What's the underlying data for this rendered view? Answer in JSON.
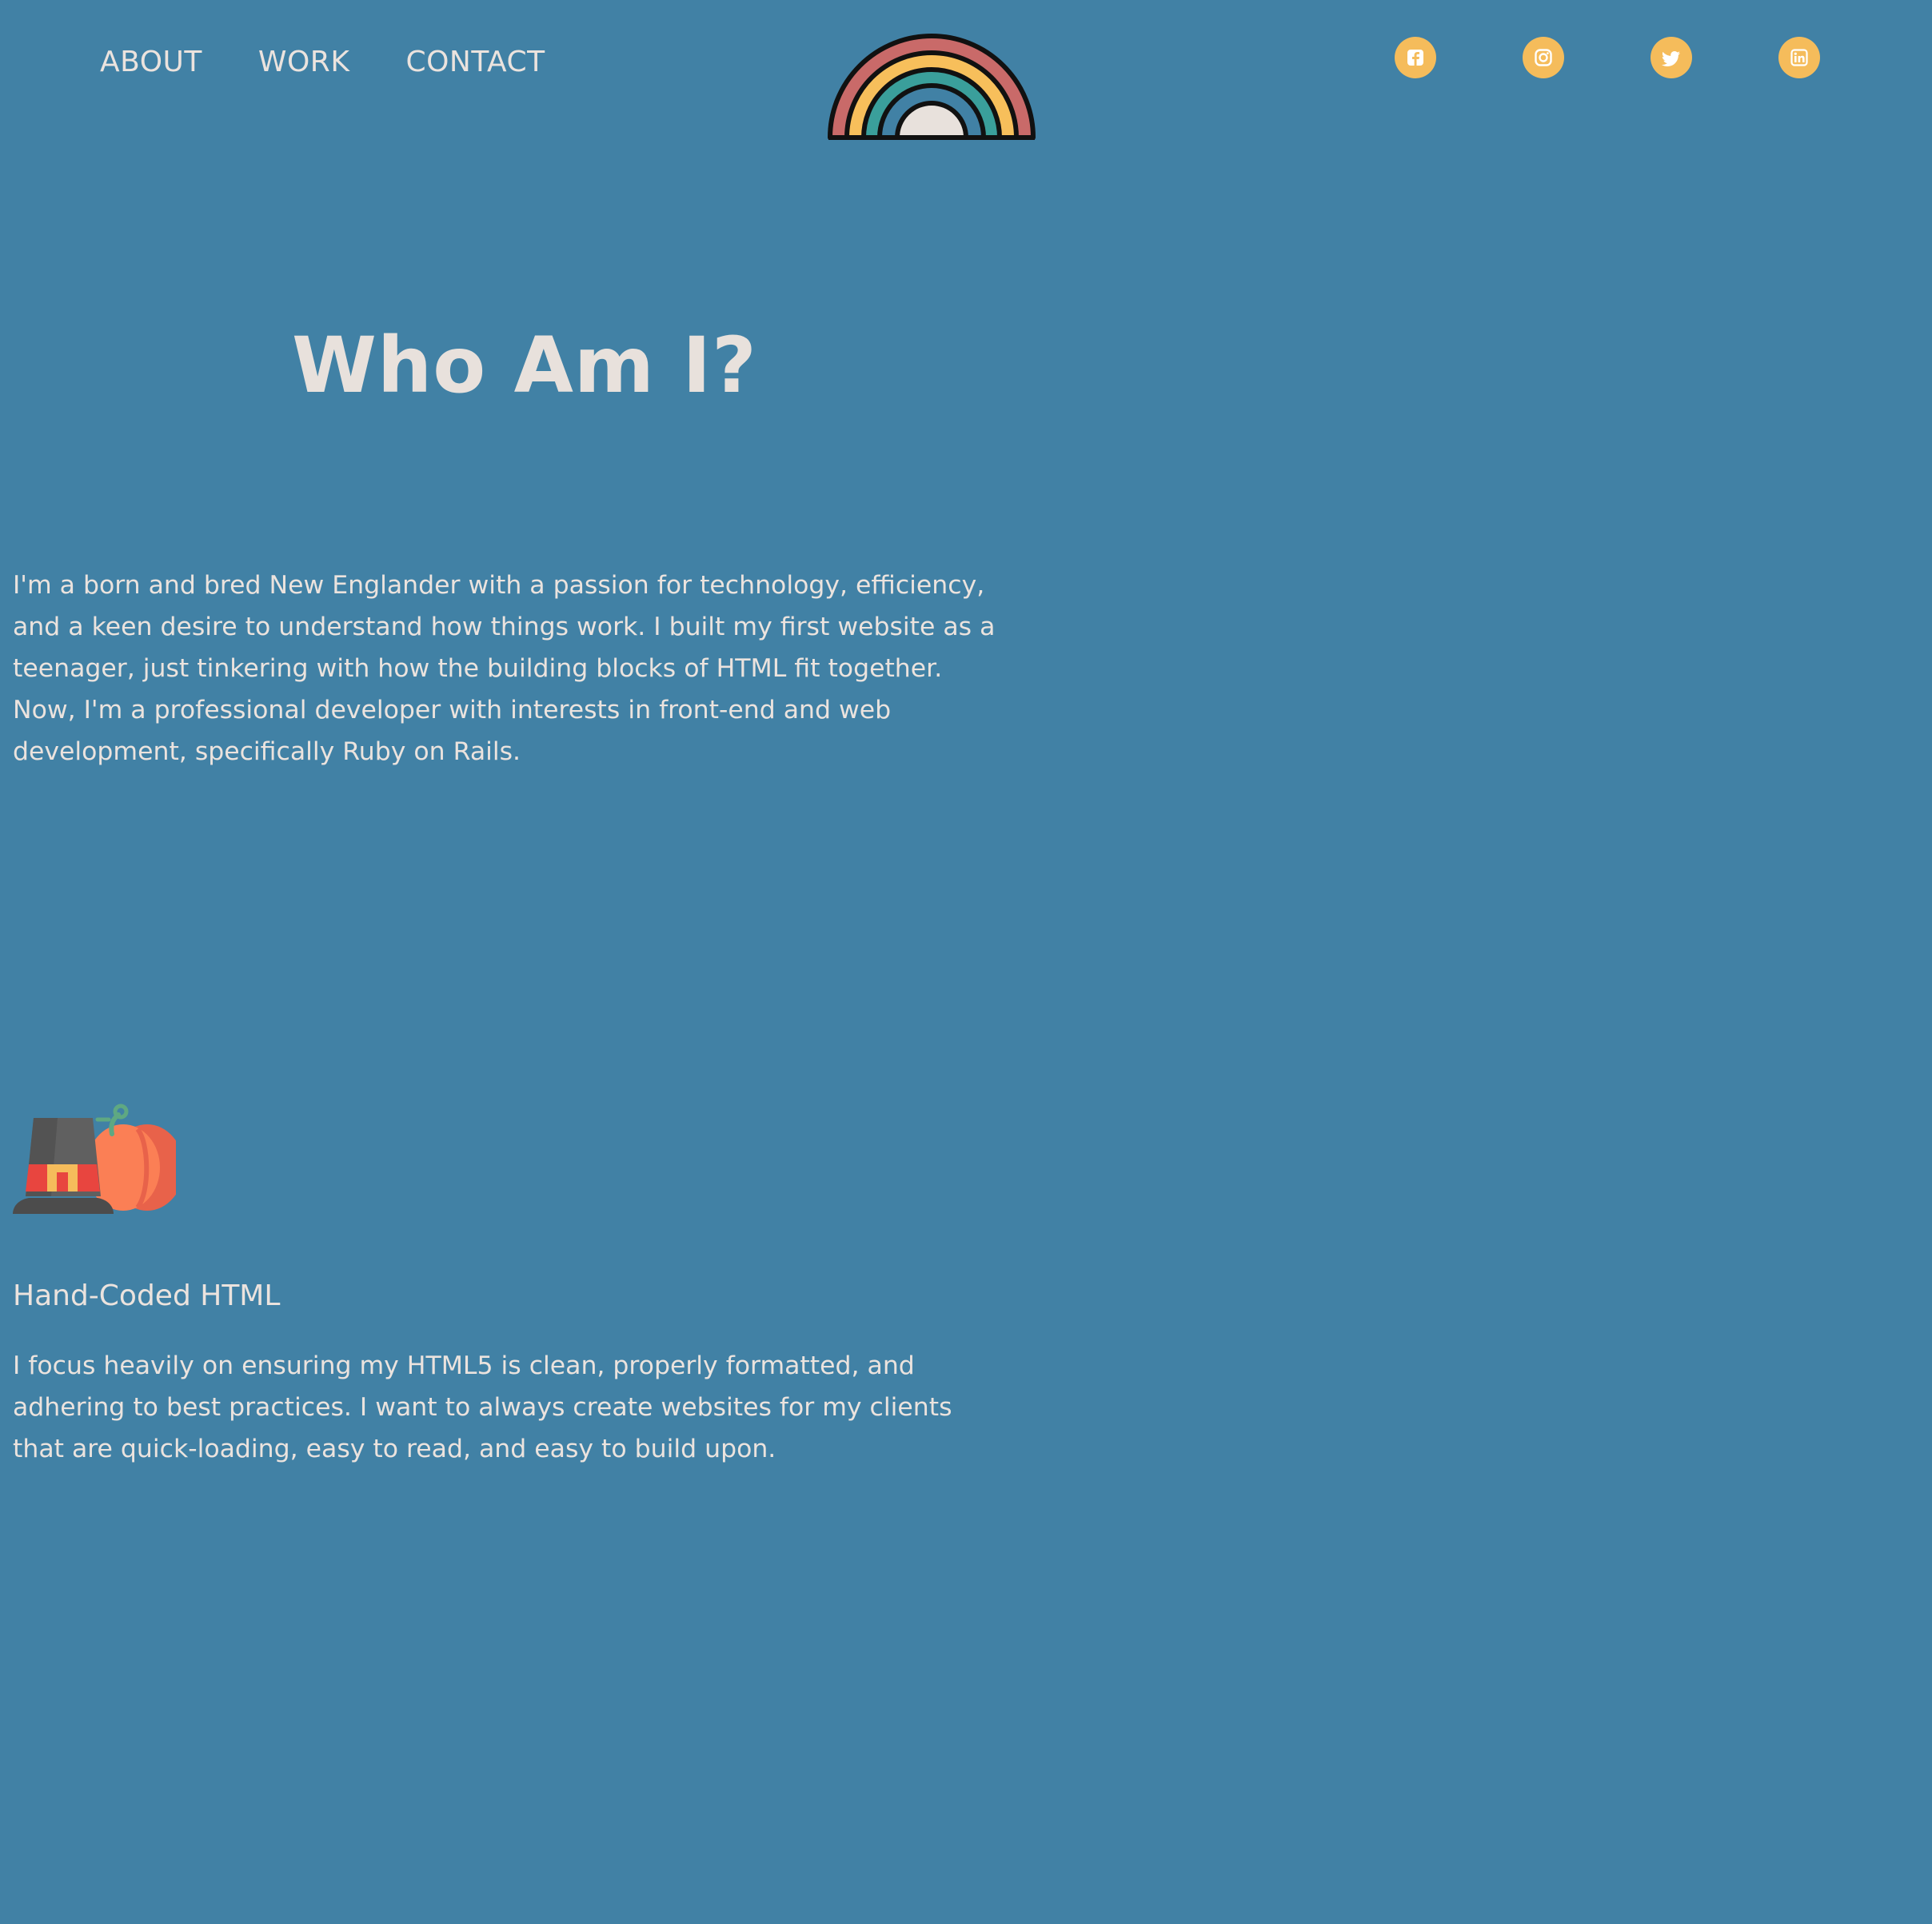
{
  "nav": {
    "items": [
      {
        "label": "ABOUT"
      },
      {
        "label": "WORK"
      },
      {
        "label": "CONTACT"
      }
    ]
  },
  "logo": {
    "icon": "rainbow-icon"
  },
  "social": {
    "icons": [
      "facebook-icon",
      "instagram-icon",
      "twitter-icon",
      "linkedin-icon"
    ],
    "accent": "#f5bc5b"
  },
  "about": {
    "heading": "Who Am I?",
    "intro": "I'm a born and bred New Englander with a passion for technology, efficiency, and a keen desire to understand how things work. I built my first website as a teenager, just tinkering with how the building blocks of HTML fit together. Now, I'm a professional developer with interests in front-end and web development, specifically Ruby on Rails."
  },
  "feature": {
    "icon": "pilgrim-hat-pumpkin-icon",
    "title": "Hand-Coded HTML",
    "text": "I focus heavily on ensuring my HTML5 is clean, properly formatted, and adhering to best practices. I want to always create websites for my clients that are quick-loading, easy to read, and easy to build upon."
  },
  "colors": {
    "background": "#4181a5",
    "text": "#ebe3de",
    "accent": "#f5bc5b"
  }
}
